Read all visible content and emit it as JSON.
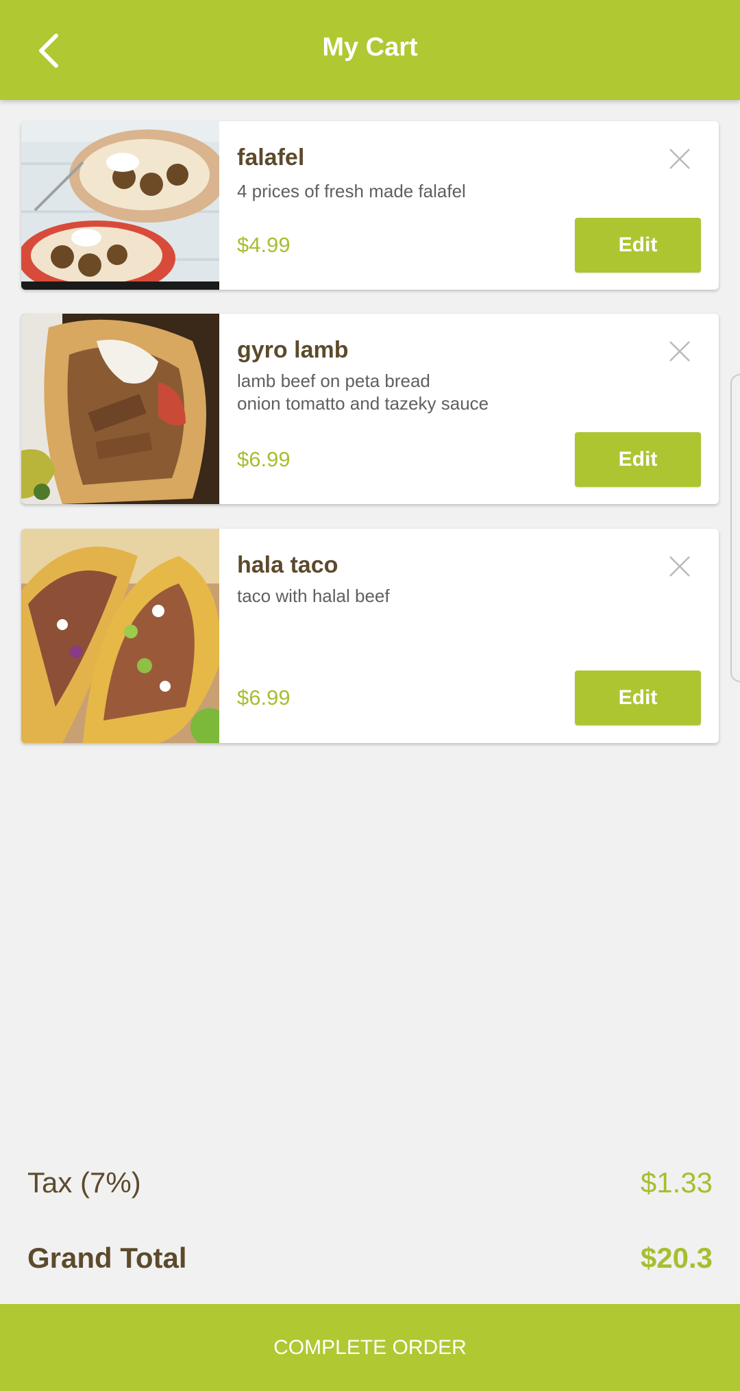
{
  "header": {
    "title": "My Cart",
    "back_icon": "chevron-left-icon"
  },
  "colors": {
    "brand": "#b0c832",
    "heading_brown": "#5c4a2c",
    "price_green": "#a6bf2f",
    "background": "#f1f1f1"
  },
  "cart": {
    "items": [
      {
        "name": "falafel",
        "description": "4 prices of fresh made falafel",
        "price": "$4.99",
        "edit_label": "Edit",
        "image": "falafel-photo"
      },
      {
        "name": "gyro lamb",
        "description": "lamb beef on peta bread\nonion tomatto and tazeky sauce",
        "price": "$6.99",
        "edit_label": "Edit",
        "image": "gyro-photo"
      },
      {
        "name": "hala taco",
        "description": "taco with halal beef",
        "price": "$6.99",
        "edit_label": "Edit",
        "image": "taco-photo"
      }
    ]
  },
  "summary": {
    "tax_label": "Tax (7%)",
    "tax_value": "$1.33",
    "total_label": "Grand Total",
    "total_value": "$20.3"
  },
  "footer": {
    "complete_label": "COMPLETE ORDER"
  }
}
